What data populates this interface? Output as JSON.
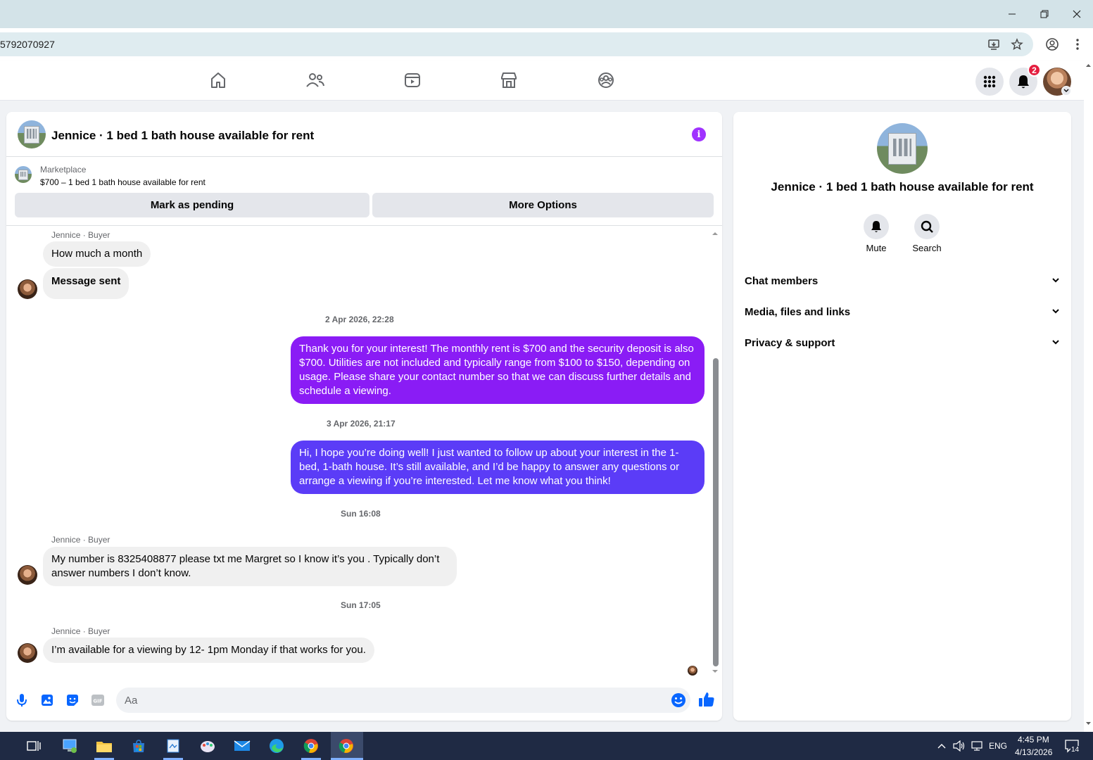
{
  "browser": {
    "url": "5792070927",
    "window_controls": {
      "minimize_icon": "minimize-icon",
      "restore_icon": "restore-icon",
      "close_icon": "close-icon"
    }
  },
  "fb_nav": {
    "tabs": [
      "home-icon",
      "friends-icon",
      "video-icon",
      "marketplace-icon",
      "groups-icon"
    ],
    "notification_count": "2"
  },
  "chat": {
    "title": "Jennice · 1 bed 1 bath house available for rent",
    "marketplace_label": "Marketplace",
    "listing": "$700 – 1 bed 1 bath house available for rent",
    "actions": {
      "pending": "Mark as pending",
      "more": "More Options"
    },
    "messages": [
      {
        "type": "sender",
        "text": "Jennice · Buyer"
      },
      {
        "type": "in",
        "text": "How much a month"
      },
      {
        "type": "in",
        "text": "Message sent"
      },
      {
        "type": "time",
        "text": "2 Apr 2026, 22:28"
      },
      {
        "type": "out",
        "text": "Thank you for your interest! The monthly rent is $700 and the security deposit is also $700. Utilities are not included and typically range from $100 to $150, depending on usage. Please share your contact number so that we can discuss further details and schedule a viewing."
      },
      {
        "type": "time",
        "text": "3 Apr 2026, 21:17"
      },
      {
        "type": "out",
        "text": "Hi, I hope you’re doing well! I just wanted to follow up about your interest in the 1-bed, 1-bath house. It’s still available, and I’d be happy to answer any questions or arrange a viewing if you’re interested. Let me know what you think!"
      },
      {
        "type": "time",
        "text": "Sun 16:08"
      },
      {
        "type": "sender",
        "text": "Jennice · Buyer"
      },
      {
        "type": "in",
        "text": "My number is 8325408877 please txt me Margret so I know it’s you . Typically don’t answer numbers I don’t know."
      },
      {
        "type": "time",
        "text": "Sun 17:05"
      },
      {
        "type": "sender",
        "text": "Jennice · Buyer"
      },
      {
        "type": "in",
        "text": "I’m available for a viewing by 12- 1pm Monday if that works for you."
      }
    ],
    "composer_placeholder": "Aa",
    "out_colors": [
      "#8a1cf5",
      "#5b3cf7"
    ]
  },
  "right_panel": {
    "name": "Jennice · 1 bed 1 bath house available for rent",
    "mute_label": "Mute",
    "search_label": "Search",
    "sections": [
      "Chat members",
      "Media, files and links",
      "Privacy & support"
    ]
  },
  "taskbar": {
    "language": "ENG",
    "time": "4:45 PM",
    "date": "4/13/2026",
    "notification_count": "14"
  }
}
